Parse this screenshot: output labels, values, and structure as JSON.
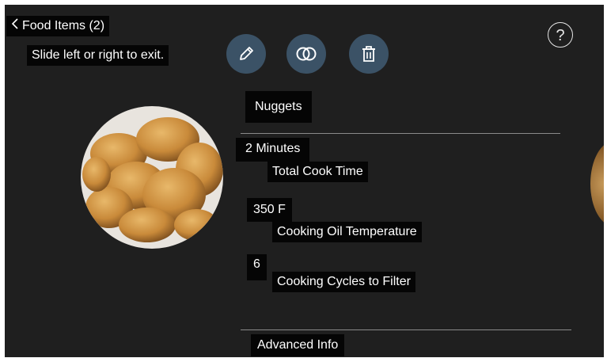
{
  "header": {
    "back_label": "Food Items (2)",
    "hint": "Slide left or right to exit."
  },
  "toolbar": {
    "edit": "pencil-icon",
    "combine": "linked-rings-icon",
    "delete": "trash-icon",
    "help_symbol": "?"
  },
  "item": {
    "name": "Nuggets",
    "cook_time_value": "2 Minutes",
    "cook_time_label": "Total Cook Time",
    "oil_temp_value": "350 F",
    "oil_temp_label": "Cooking Oil Temperature",
    "cycles_value": "6",
    "cycles_label": "Cooking Cycles to Filter",
    "advanced_label": "Advanced Info"
  },
  "colors": {
    "background": "#1f1f1f",
    "button": "#3b5266",
    "label_bg": "#050505"
  }
}
